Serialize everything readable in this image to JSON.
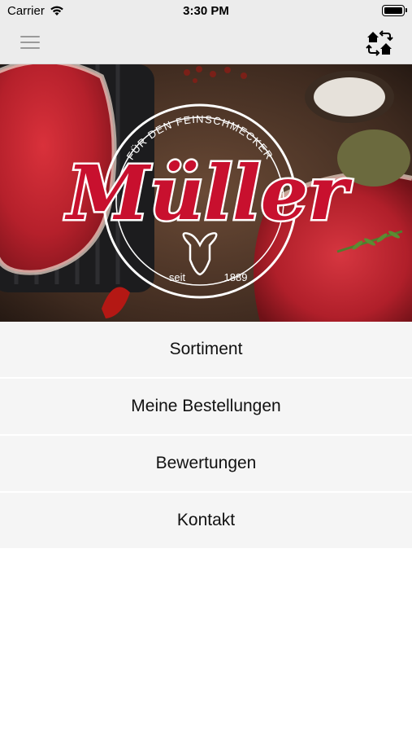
{
  "status_bar": {
    "carrier": "Carrier",
    "time": "3:30 PM",
    "icons": [
      "wifi-icon",
      "battery-icon"
    ]
  },
  "nav": {
    "menu_icon": "hamburger-menu-icon",
    "switch_icon": "switch-store-icon"
  },
  "hero": {
    "logo_arc_text": "FÜR DEN FEINSCHMECKER",
    "logo_brand": "Müller",
    "logo_since": "seit",
    "logo_year": "1889",
    "colors": {
      "brand_red": "#c8102e",
      "logo_white": "#ffffff"
    }
  },
  "menu": {
    "items": [
      {
        "label": "Sortiment"
      },
      {
        "label": "Meine Bestellungen"
      },
      {
        "label": "Bewertungen"
      },
      {
        "label": "Kontakt"
      }
    ]
  },
  "colors": {
    "bar_background": "#ececec",
    "menu_item_background": "#f5f5f5"
  }
}
